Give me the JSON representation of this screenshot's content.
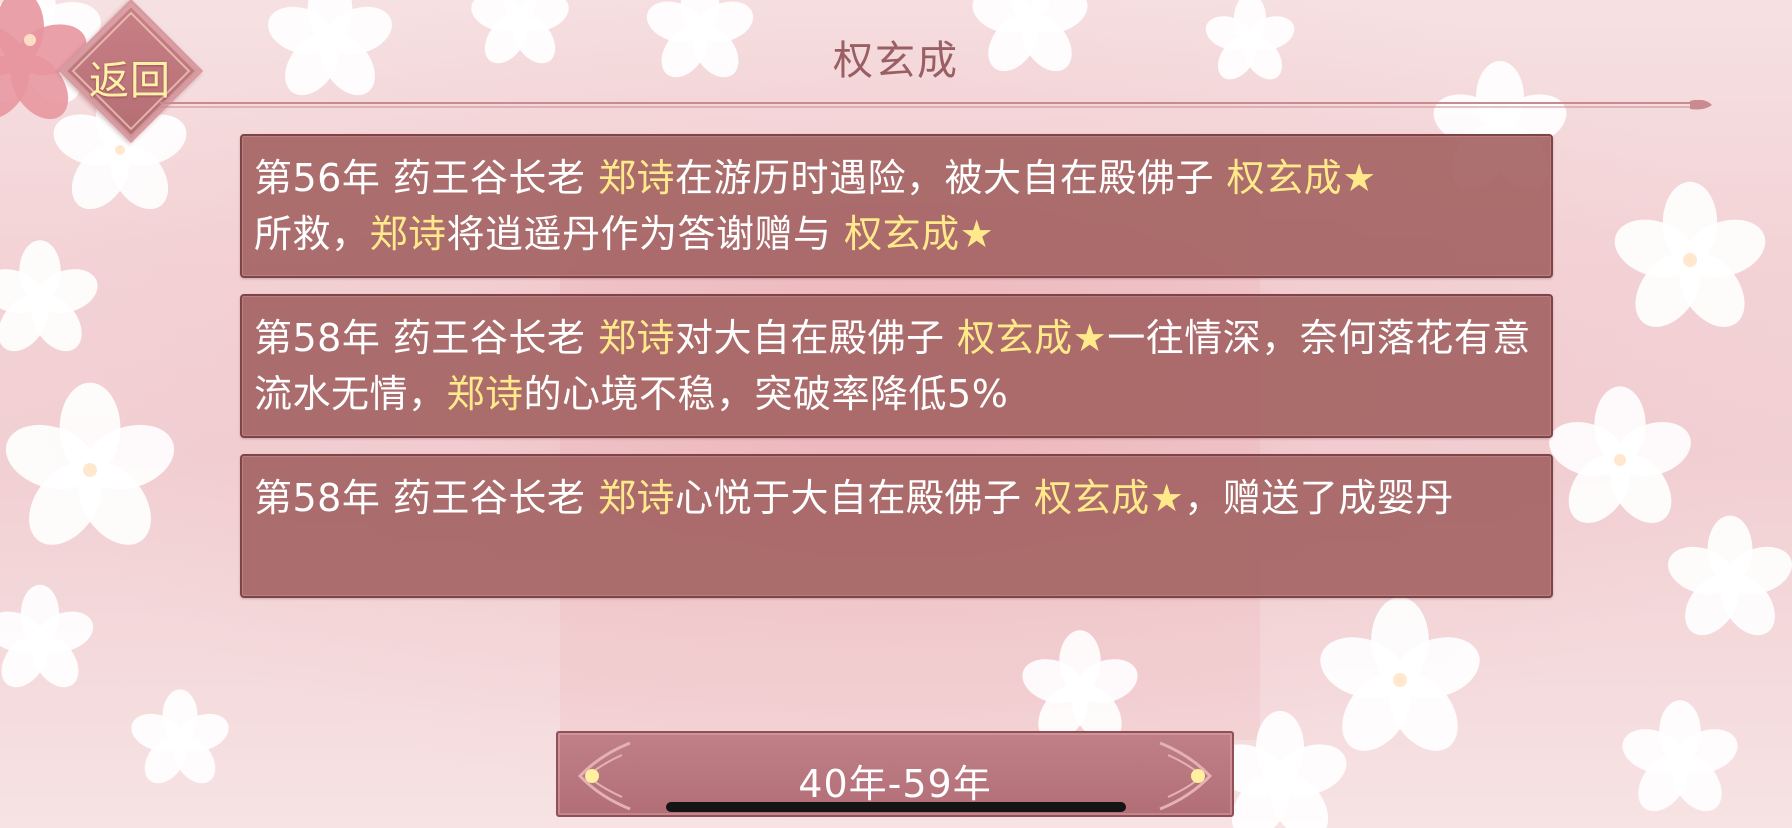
{
  "header": {
    "back_label": "返回",
    "title": "权玄成"
  },
  "events": [
    {
      "segments": [
        {
          "text": "第56年 药王谷长老 ",
          "highlight": false
        },
        {
          "text": "郑诗",
          "highlight": true
        },
        {
          "text": "在游历时遇险，被大自在殿佛子 ",
          "highlight": false
        },
        {
          "text": "权玄成★",
          "highlight": true
        },
        {
          "text": "所救，",
          "highlight": false
        },
        {
          "text": "郑诗",
          "highlight": true
        },
        {
          "text": "将逍遥丹作为答谢赠与 ",
          "highlight": false
        },
        {
          "text": "权玄成★",
          "highlight": true
        }
      ]
    },
    {
      "segments": [
        {
          "text": "第58年 药王谷长老 ",
          "highlight": false
        },
        {
          "text": "郑诗",
          "highlight": true
        },
        {
          "text": "对大自在殿佛子 ",
          "highlight": false
        },
        {
          "text": "权玄成★",
          "highlight": true
        },
        {
          "text": "一往情深，奈何落花有意流水无情，",
          "highlight": false
        },
        {
          "text": "郑诗",
          "highlight": true
        },
        {
          "text": "的心境不稳，突破率降低5%",
          "highlight": false
        }
      ]
    },
    {
      "segments": [
        {
          "text": "第58年 药王谷长老 ",
          "highlight": false
        },
        {
          "text": "郑诗",
          "highlight": true
        },
        {
          "text": "心悦于大自在殿佛子 ",
          "highlight": false
        },
        {
          "text": "权玄成★",
          "highlight": true
        },
        {
          "text": "，赠送了成婴丹",
          "highlight": false
        }
      ]
    }
  ],
  "period": {
    "label": "40年-59年"
  },
  "colors": {
    "highlight": "#ffe98a",
    "card_bg": "#a56464",
    "title": "#9a5f64"
  }
}
